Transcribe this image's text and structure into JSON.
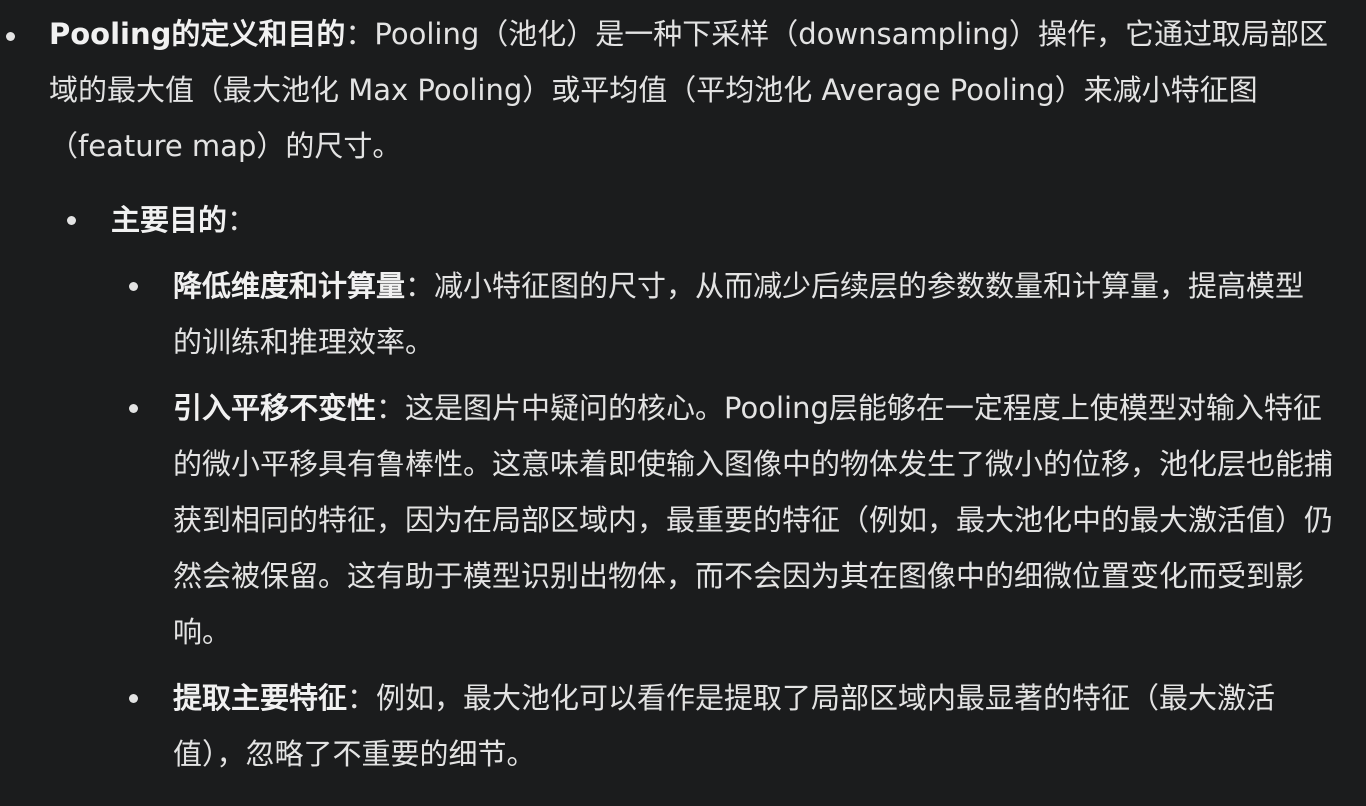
{
  "pooling": {
    "term": "Pooling的定义和目的",
    "sep": "：",
    "body": "Pooling（池化）是一种下采样（downsampling）操作，它通过取局部区域的最大值（最大池化 Max Pooling）或平均值（平均池化 Average Pooling）来减小特征图（feature map）的尺寸。"
  },
  "purpose": {
    "term": "主要目的",
    "sep": "："
  },
  "points": [
    {
      "term": "降低维度和计算量",
      "sep": "：",
      "body": "减小特征图的尺寸，从而减少后续层的参数数量和计算量，提高模型的训练和推理效率。"
    },
    {
      "term": "引入平移不变性",
      "sep": "：",
      "body": "这是图片中疑问的核心。Pooling层能够在一定程度上使模型对输入特征的微小平移具有鲁棒性。这意味着即使输入图像中的物体发生了微小的位移，池化层也能捕获到相同的特征，因为在局部区域内，最重要的特征（例如，最大池化中的最大激活值）仍然会被保留。这有助于模型识别出物体，而不会因为其在图像中的细微位置变化而受到影响。"
    },
    {
      "term": "提取主要特征",
      "sep": "：",
      "body": "例如，最大池化可以看作是提取了局部区域内最显著的特征（最大激活值），忽略了不重要的细节。"
    }
  ]
}
